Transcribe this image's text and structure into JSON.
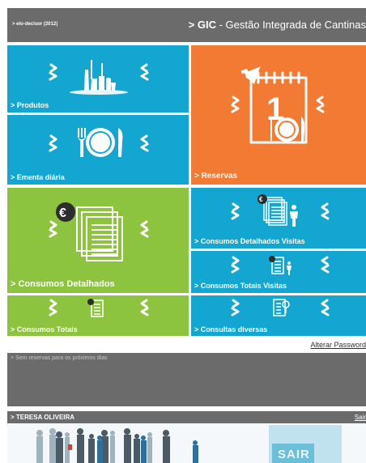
{
  "header": {
    "left_text": "> elo-decisor (2012)",
    "app_name": "> GIC",
    "app_desc": " - Gestão Integrada de Cantinas"
  },
  "tiles": {
    "produtos": "> Produtos",
    "ementa": "> Ementa diária",
    "reservas": "> Reservas",
    "consumos_detalhados": "> Consumos Detalhados",
    "consumos_det_visitas": "> Consumos Detalhados Visitas",
    "consumos_totais_visitas": "> Consumos Totais Visitas",
    "consumos_totais": "> Consumos Totais",
    "consultas_diversas": "> Consultas diversas"
  },
  "links": {
    "alterar_password": "Alterar Password"
  },
  "notice": {
    "text": "> Sem reservas para os próximos dias"
  },
  "user": {
    "name": "> TERESA OLIVEIRA",
    "sair_link": "Sair",
    "banner_label": "SAIR"
  },
  "colors": {
    "blue": "#12a6d1",
    "orange": "#f27a33",
    "green": "#8dc43f",
    "gray": "#6b6b6b"
  }
}
